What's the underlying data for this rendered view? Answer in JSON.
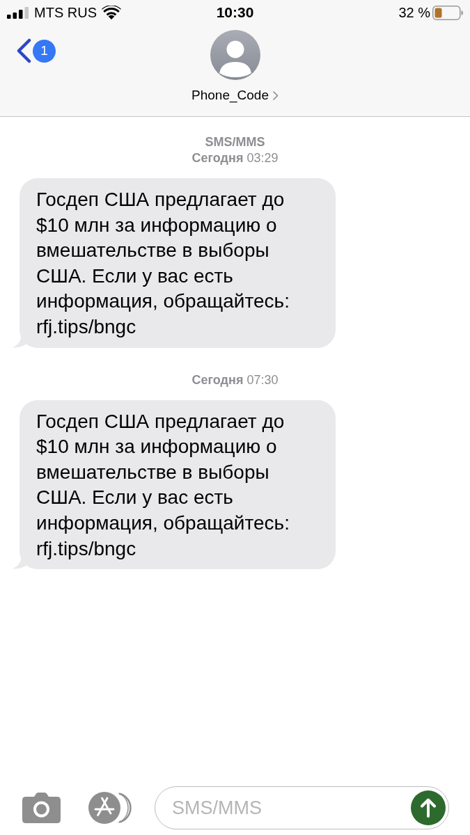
{
  "status_bar": {
    "carrier": "MTS RUS",
    "time": "10:30",
    "battery": "32 %"
  },
  "header": {
    "unread_count": "1",
    "contact_name": "Phone_Code"
  },
  "thread": [
    {
      "kind": "label",
      "text": "SMS/MMS"
    },
    {
      "kind": "timestamp",
      "text": "**Сегодня** 03:29"
    },
    {
      "kind": "message",
      "text": "Госдеп США предлагает до $10 млн за информацию о вмешательстве в выборы США. Если у вас есть информация, обращайтесь: rfj.tips/bngc"
    },
    {
      "kind": "timestamp",
      "text": "**Сегодня** 07:30"
    },
    {
      "kind": "message",
      "text": "Госдеп США предлагает до $10 млн за информацию о вмешательстве в выборы США. Если у вас есть информация, обращайтесь: rfj.tips/bngc"
    }
  ],
  "compose": {
    "placeholder": "SMS/MMS"
  }
}
